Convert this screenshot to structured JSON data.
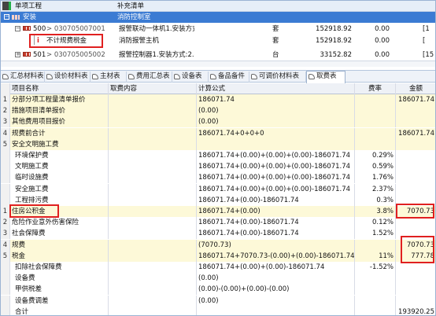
{
  "tree": {
    "header": {
      "col1": "单项工程",
      "col2": "补充清单"
    },
    "selected": {
      "name": "安装",
      "desc": "消防控制室"
    },
    "rows": [
      {
        "level": "—",
        "code": "500",
        "id": "030705007001",
        "desc": "报警联动一体机1.安装方式:消防报警主机2.控制:",
        "unit": "套",
        "price": "152918.92",
        "rate": "0.00",
        "extra": "[1"
      },
      {
        "level": "",
        "code": "",
        "id": "",
        "name": "不计规费税金",
        "desc": "消防报警主机",
        "unit": "套",
        "price": "152918.92",
        "rate": "0.00",
        "extra": "["
      },
      {
        "level": "+",
        "code": "501",
        "id": "030705005002",
        "desc": "报警控制器1.安装方式:2.控制点数:",
        "unit": "台",
        "price": "33152.82",
        "rate": "0.00",
        "extra": "[15"
      }
    ]
  },
  "tabs": [
    "汇总材料表",
    "设价材料表",
    "主材表",
    "费用汇总表",
    "设备表",
    "备品备件",
    "可调价材料表",
    "取费表"
  ],
  "active_tab": "取费表",
  "table": {
    "headers": {
      "name": "项目名称",
      "content": "取费内容",
      "formula": "计算公式",
      "rate": "费率",
      "amount": "金额"
    },
    "rows": [
      {
        "idx": "1",
        "name": "分部分项工程量清单报价",
        "content": "",
        "formula": "186071.74",
        "rate": "",
        "amount": "186071.74",
        "bg": "y"
      },
      {
        "idx": "2",
        "name": "措施项目清单报价",
        "content": "",
        "formula": "(0.00)",
        "rate": "",
        "amount": "",
        "bg": "y"
      },
      {
        "idx": "3",
        "name": "其他费用项目报价",
        "content": "",
        "formula": "(0.00)",
        "rate": "",
        "amount": "",
        "bg": "y"
      },
      {
        "idx": "4",
        "name": "规费前合计",
        "content": "",
        "formula": "186071.74+0+0+0",
        "rate": "",
        "amount": "186071.74",
        "bg": "y"
      },
      {
        "idx": "5",
        "name": "安全文明施工费",
        "content": "",
        "formula": "",
        "rate": "",
        "amount": "",
        "bg": "y"
      },
      {
        "idx": "",
        "name": "环境保护费",
        "content": "",
        "formula": "186071.74+(0.00)+(0.00)+(0.00)-186071.74",
        "rate": "0.29%",
        "amount": "",
        "bg": "w"
      },
      {
        "idx": "",
        "name": "文明施工费",
        "content": "",
        "formula": "186071.74+(0.00)+(0.00)+(0.00)-186071.74",
        "rate": "0.59%",
        "amount": "",
        "bg": "w"
      },
      {
        "idx": "",
        "name": "临时设施费",
        "content": "",
        "formula": "186071.74+(0.00)+(0.00)+(0.00)-186071.74",
        "rate": "1.76%",
        "amount": "",
        "bg": "w"
      },
      {
        "idx": "",
        "name": "安全施工费",
        "content": "",
        "formula": "186071.74+(0.00)+(0.00)+(0.00)-186071.74",
        "rate": "2.37%",
        "amount": "",
        "bg": "w"
      },
      {
        "idx": "",
        "name": "工程排污费",
        "content": "",
        "formula": "186071.74+(0.00)-186071.74",
        "rate": "0.3%",
        "amount": "",
        "bg": "w"
      },
      {
        "idx": "1",
        "name": "住房公积金",
        "content": "",
        "formula": "186071.74+(0.00)",
        "rate": "3.8%",
        "amount": "7070.73",
        "bg": "y"
      },
      {
        "idx": "2",
        "name": "危险作业意外伤害保险",
        "content": "",
        "formula": "186071.74+(0.00)-186071.74",
        "rate": "0.12%",
        "amount": "",
        "bg": "w"
      },
      {
        "idx": "3",
        "name": "社会保障费",
        "content": "",
        "formula": "186071.74+(0.00)-186071.74",
        "rate": "1.52%",
        "amount": "",
        "bg": "w"
      },
      {
        "idx": "4",
        "name": "规费",
        "content": "",
        "formula": "(7070.73)",
        "rate": "",
        "amount": "7070.73",
        "bg": "y"
      },
      {
        "idx": "5",
        "name": "税金",
        "content": "",
        "formula": "186071.74+7070.73-(0.00)+(0.00)-186071.74",
        "rate": "11%",
        "amount": "777.78",
        "bg": "y"
      },
      {
        "idx": "",
        "name": "扣除社会保障费",
        "content": "",
        "formula": "186071.74+(0.00)+(0.00)-186071.74",
        "rate": "-1.52%",
        "amount": "",
        "bg": "w"
      },
      {
        "idx": "",
        "name": "设备费",
        "content": "",
        "formula": "(0.00)",
        "rate": "",
        "amount": "",
        "bg": "w"
      },
      {
        "idx": "",
        "name": "甲供税差",
        "content": "",
        "formula": "(0.00)-(0.00)+(0.00)-(0.00)",
        "rate": "",
        "amount": "",
        "bg": "w"
      },
      {
        "idx": "",
        "name": "设备费调差",
        "content": "",
        "formula": "(0.00)",
        "rate": "",
        "amount": "",
        "bg": "w"
      },
      {
        "idx": "",
        "name": "合计",
        "content": "",
        "formula": "",
        "rate": "",
        "amount": "193920.25",
        "bg": "w"
      }
    ]
  },
  "colors": {
    "selection": "#3b7bd3",
    "highlight": "#e02020",
    "row_yellow": "#fdf9d8"
  }
}
